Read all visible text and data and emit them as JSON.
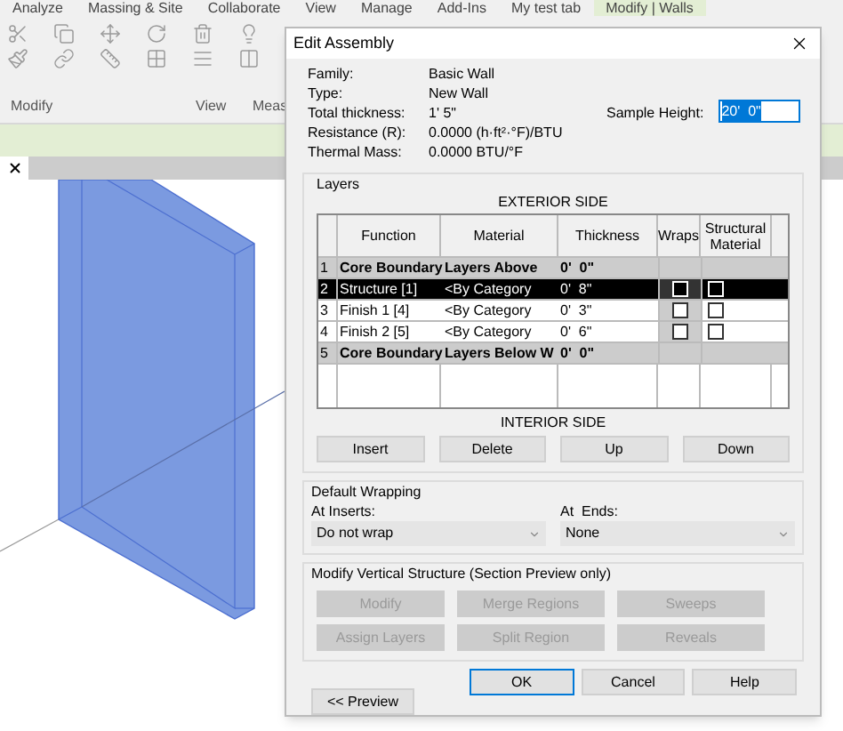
{
  "ribbon": {
    "tabs": [
      {
        "label": "Analyze",
        "selected": false
      },
      {
        "label": "Massing & Site",
        "selected": false
      },
      {
        "label": "Collaborate",
        "selected": false
      },
      {
        "label": "View",
        "selected": false
      },
      {
        "label": "Manage",
        "selected": false
      },
      {
        "label": "Add-Ins",
        "selected": false
      },
      {
        "label": "My test tab",
        "selected": false
      },
      {
        "label": "Modify | Walls",
        "selected": true
      }
    ],
    "panels": [
      {
        "label": "Modify"
      },
      {
        "label": "View"
      },
      {
        "label": "Meas"
      }
    ]
  },
  "dialog": {
    "title": "Edit Assembly",
    "info": [
      {
        "label": "Family:",
        "value": "Basic Wall"
      },
      {
        "label": "Type:",
        "value": "New Wall"
      },
      {
        "label": "Total thickness:",
        "value": "1'  5\""
      },
      {
        "label": "Resistance (R):",
        "value": "0.0000 (h·ft²·°F)/BTU"
      },
      {
        "label": "Thermal Mass:",
        "value": "0.0000 BTU/°F"
      }
    ],
    "sample_height": {
      "label": "Sample Height:",
      "value": "20'  0\"",
      "highlighted": true
    },
    "layers": {
      "title": "Layers",
      "exterior_label": "EXTERIOR SIDE",
      "columns": [
        "Function",
        "Material",
        "Thickness",
        "Wraps",
        "Structural Material"
      ],
      "rows": [
        {
          "index": "1",
          "kind": "boundary",
          "selected": false,
          "function": "Core Boundary",
          "material": "Layers Above",
          "thickness": "0'  0\""
        },
        {
          "index": "2",
          "kind": "layer",
          "selected": true,
          "function": "Structure [1]",
          "material": "<By Category",
          "thickness": "0'  8\"",
          "wraps": false,
          "structural": false
        },
        {
          "index": "3",
          "kind": "layer",
          "selected": false,
          "function": "Finish 1 [4]",
          "material": "<By Category",
          "thickness": "0'  3\"",
          "wraps": false,
          "structural": false
        },
        {
          "index": "4",
          "kind": "layer",
          "selected": false,
          "function": "Finish 2 [5]",
          "material": "<By Category",
          "thickness": "0'  6\"",
          "wraps": false,
          "structural": false
        },
        {
          "index": "5",
          "kind": "boundary",
          "selected": false,
          "function": "Core Boundary",
          "material": "Layers Below W",
          "thickness": "0'  0\""
        }
      ],
      "interior_label": "INTERIOR SIDE",
      "buttons": [
        "Insert",
        "Delete",
        "Up",
        "Down"
      ]
    },
    "default_wrapping": {
      "title": "Default Wrapping",
      "at_inserts": {
        "label": "At Inserts:",
        "value": "Do not wrap"
      },
      "at_ends": {
        "label": "At  Ends:",
        "value": "None"
      }
    },
    "vertical_structure": {
      "title": "Modify Vertical Structure (Section Preview only)",
      "buttons": [
        {
          "label": "Modify",
          "disabled": true
        },
        {
          "label": "Merge Regions",
          "disabled": true
        },
        {
          "label": "Sweeps",
          "disabled": true
        },
        {
          "label": "Assign Layers",
          "disabled": true
        },
        {
          "label": "Split Region",
          "disabled": true
        },
        {
          "label": "Reveals",
          "disabled": true
        }
      ]
    },
    "footer_buttons": [
      {
        "label": "OK",
        "default": true
      },
      {
        "label": "Cancel",
        "default": false
      },
      {
        "label": "Help",
        "default": false
      }
    ],
    "preview_button": "<< Preview"
  }
}
